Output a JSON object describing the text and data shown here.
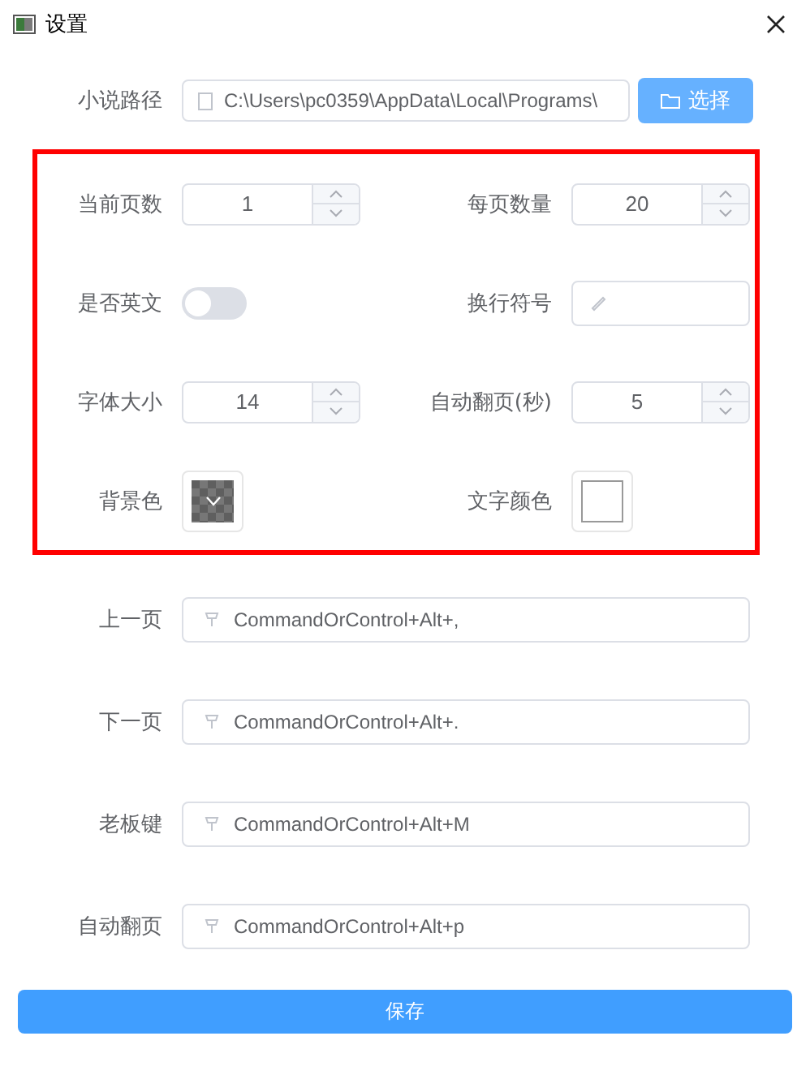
{
  "window": {
    "title": "设置"
  },
  "path": {
    "label": "小说路径",
    "value": "C:\\Users\\pc0359\\AppData\\Local\\Programs\\",
    "button": "选择"
  },
  "highlight": {
    "shown": true
  },
  "settings": [
    {
      "kind": "number",
      "label": "当前页数",
      "value": "1"
    },
    {
      "kind": "number",
      "label": "每页数量",
      "value": "20"
    },
    {
      "kind": "switch",
      "label": "是否英文",
      "on": false
    },
    {
      "kind": "text",
      "label": "换行符号"
    },
    {
      "kind": "number",
      "label": "字体大小",
      "value": "14"
    },
    {
      "kind": "number",
      "label": "自动翻页(秒)",
      "value": "5"
    },
    {
      "kind": "color",
      "label": "背景色",
      "color": "#5f5f5f",
      "transparent": true
    },
    {
      "kind": "color",
      "label": "文字颜色",
      "color": "#ffffff",
      "transparent": false
    }
  ],
  "shortcuts": [
    {
      "label": "上一页",
      "value": "CommandOrControl+Alt+,"
    },
    {
      "label": "下一页",
      "value": "CommandOrControl+Alt+."
    },
    {
      "label": "老板键",
      "value": "CommandOrControl+Alt+M"
    },
    {
      "label": "自动翻页",
      "value": "CommandOrControl+Alt+p"
    }
  ],
  "save_button": "保存"
}
